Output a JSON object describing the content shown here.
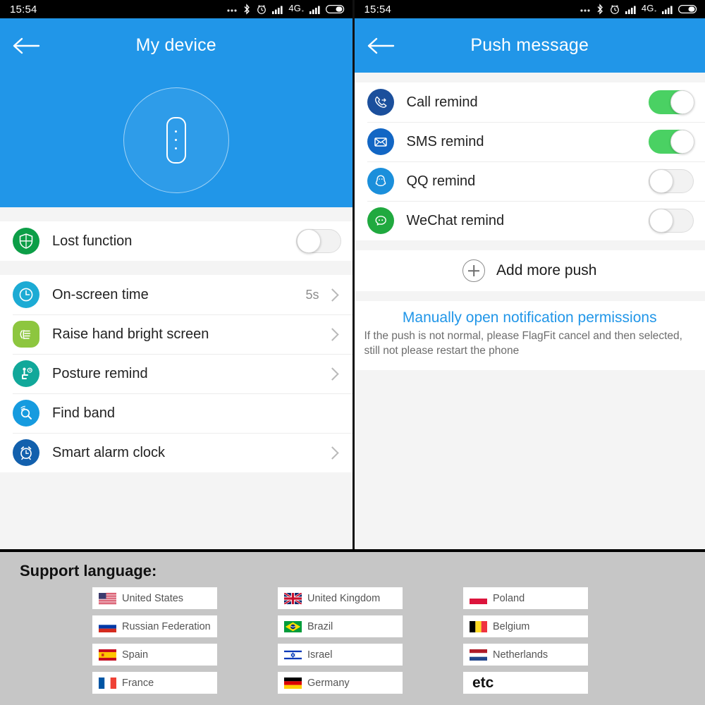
{
  "statusbar": {
    "time": "15:54",
    "network_label": "4G",
    "network_sub": "⁺",
    "icons": [
      "more-dots-icon",
      "bluetooth-icon",
      "alarm-clock-icon",
      "signal-bars-icon",
      "signal-bars-icon",
      "battery-icon"
    ]
  },
  "left_screen": {
    "title": "My device",
    "back_label": "←",
    "device_image_alt": "smart-band",
    "toggle_section": {
      "label": "Lost function",
      "icon": "shield-icon",
      "icon_color": "#0c9e47",
      "toggle_state": "off"
    },
    "items": [
      {
        "label": "On-screen time",
        "icon": "clock-icon",
        "icon_color": "#1cabd4",
        "value": "5s",
        "chevron": true
      },
      {
        "label": "Raise hand bright screen",
        "icon": "hand-raise-icon",
        "icon_color": "#8dc63f",
        "value": "",
        "chevron": true
      },
      {
        "label": "Posture remind",
        "icon": "posture-icon",
        "icon_color": "#11a89a",
        "value": "",
        "chevron": true
      },
      {
        "label": "Find band",
        "icon": "search-band-icon",
        "icon_color": "#169bdf",
        "value": "",
        "chevron": false
      },
      {
        "label": "Smart alarm clock",
        "icon": "alarm-clock-icon",
        "icon_color": "#1260ad",
        "value": "",
        "chevron": true
      }
    ]
  },
  "right_screen": {
    "title": "Push message",
    "back_label": "←",
    "push_items": [
      {
        "label": "Call remind",
        "icon": "phone-icon",
        "icon_color": "#1b4f9c",
        "toggle_state": "on"
      },
      {
        "label": "SMS remind",
        "icon": "envelope-icon",
        "icon_color": "#1266c4",
        "toggle_state": "on"
      },
      {
        "label": "QQ remind",
        "icon": "qq-penguin-icon",
        "icon_color": "#1b8fdb",
        "toggle_state": "off"
      },
      {
        "label": "WeChat remind",
        "icon": "wechat-icon",
        "icon_color": "#20a93f",
        "toggle_state": "off"
      }
    ],
    "add_more": {
      "label": "Add more push",
      "icon": "plus-circle-icon"
    },
    "note": {
      "link": "Manually open notification permissions",
      "text": "If the push is not normal, please FlagFit cancel and then selected, still not please restart the phone"
    }
  },
  "language_section": {
    "title": "Support language:",
    "columns": [
      [
        {
          "name": "United States",
          "flag": "us"
        },
        {
          "name": "Russian Federation",
          "flag": "ru"
        },
        {
          "name": "Spain",
          "flag": "es"
        },
        {
          "name": "France",
          "flag": "fr"
        }
      ],
      [
        {
          "name": "United Kingdom",
          "flag": "gb"
        },
        {
          "name": "Brazil",
          "flag": "br"
        },
        {
          "name": "Israel",
          "flag": "il"
        },
        {
          "name": "Germany",
          "flag": "de"
        }
      ],
      [
        {
          "name": "Poland",
          "flag": "pl"
        },
        {
          "name": "Belgium",
          "flag": "be"
        },
        {
          "name": "Netherlands",
          "flag": "nl"
        },
        {
          "name": "etc",
          "flag": "none"
        }
      ]
    ]
  },
  "colors": {
    "accent_blue": "#2196e8",
    "toggle_on_green": "#4ad163",
    "page_bg": "#f4f4f4",
    "language_bg": "#c6c6c6"
  }
}
